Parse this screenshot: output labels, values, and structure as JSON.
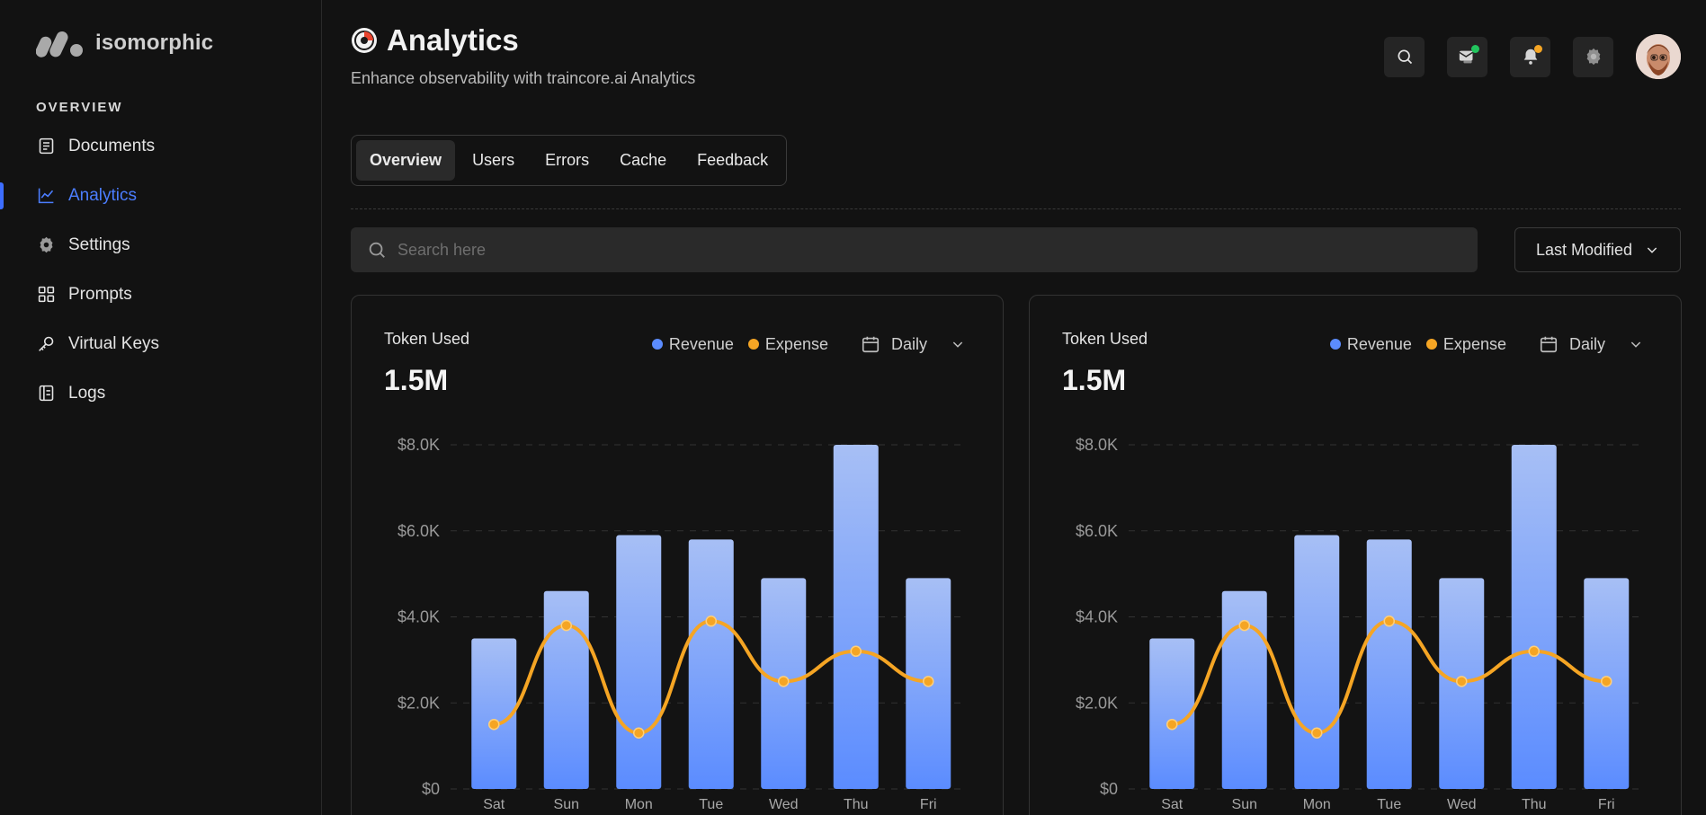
{
  "brand": {
    "name": "isomorphic"
  },
  "sidebar": {
    "section_label": "OVERVIEW",
    "items": [
      {
        "label": "Documents",
        "icon": "document-icon",
        "active": false
      },
      {
        "label": "Analytics",
        "icon": "chart-line-icon",
        "active": true
      },
      {
        "label": "Settings",
        "icon": "gear-icon",
        "active": false
      },
      {
        "label": "Prompts",
        "icon": "grid-icon",
        "active": false
      },
      {
        "label": "Virtual Keys",
        "icon": "key-icon",
        "active": false
      },
      {
        "label": "Logs",
        "icon": "log-icon",
        "active": false
      }
    ]
  },
  "header": {
    "title": "Analytics",
    "subtitle": "Enhance observability with traincore.ai Analytics"
  },
  "top_actions": {
    "message_dot_color": "#22c55e",
    "notification_dot_color": "#f5a524"
  },
  "tabs": [
    {
      "label": "Overview",
      "active": true
    },
    {
      "label": "Users",
      "active": false
    },
    {
      "label": "Errors",
      "active": false
    },
    {
      "label": "Cache",
      "active": false
    },
    {
      "label": "Feedback",
      "active": false
    }
  ],
  "search": {
    "placeholder": "Search here",
    "value": ""
  },
  "sort": {
    "label": "Last Modified"
  },
  "cards": [
    {
      "label": "Token Used",
      "value": "1.5M",
      "legend_revenue": "Revenue",
      "legend_expense": "Expense",
      "period": "Daily"
    },
    {
      "label": "Token Used",
      "value": "1.5M",
      "legend_revenue": "Revenue",
      "legend_expense": "Expense",
      "period": "Daily"
    }
  ],
  "colors": {
    "accent": "#4b7dff",
    "revenue": "#5b8cff",
    "expense": "#f5a524"
  },
  "chart_data": [
    {
      "type": "bar",
      "categories": [
        "Sat",
        "Sun",
        "Mon",
        "Tue",
        "Wed",
        "Thu",
        "Fri"
      ],
      "series": [
        {
          "name": "Revenue",
          "type": "bar",
          "values": [
            3500,
            4600,
            5900,
            5800,
            4900,
            8000,
            4900
          ]
        },
        {
          "name": "Expense",
          "type": "line",
          "values": [
            1500,
            3800,
            1300,
            3900,
            2500,
            3200,
            2500
          ]
        }
      ],
      "yticks": [
        "$0",
        "$2.0K",
        "$4.0K",
        "$6.0K",
        "$8.0K"
      ],
      "ylim": [
        0,
        8000
      ],
      "grid": true
    },
    {
      "type": "bar",
      "categories": [
        "Sat",
        "Sun",
        "Mon",
        "Tue",
        "Wed",
        "Thu",
        "Fri"
      ],
      "series": [
        {
          "name": "Revenue",
          "type": "bar",
          "values": [
            3500,
            4600,
            5900,
            5800,
            4900,
            8000,
            4900
          ]
        },
        {
          "name": "Expense",
          "type": "line",
          "values": [
            1500,
            3800,
            1300,
            3900,
            2500,
            3200,
            2500
          ]
        }
      ],
      "yticks": [
        "$0",
        "$2.0K",
        "$4.0K",
        "$6.0K",
        "$8.0K"
      ],
      "ylim": [
        0,
        8000
      ],
      "grid": true
    }
  ]
}
